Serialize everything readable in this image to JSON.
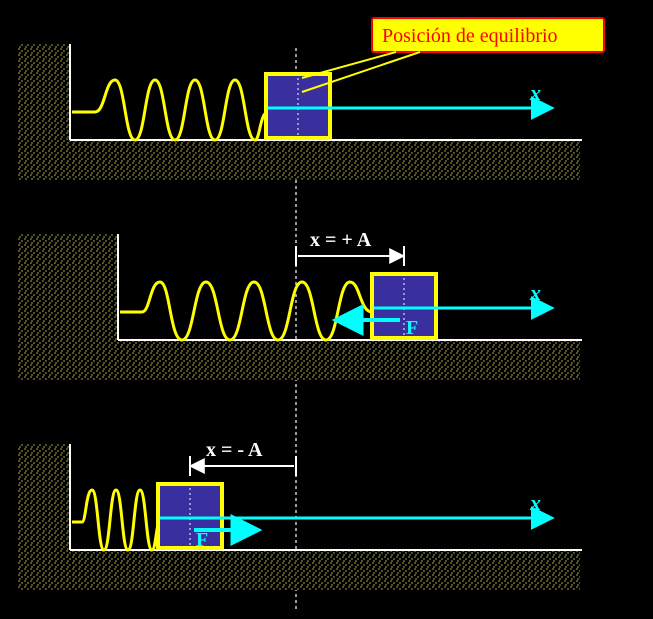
{
  "callout": {
    "label": "Posición de equilibrio"
  },
  "axes": {
    "x1": "x",
    "x2": "x",
    "x3": "x"
  },
  "displacement": {
    "positive": "x = + A",
    "negative": "x = - A"
  },
  "forces": {
    "f2": "F",
    "f3": "F"
  },
  "colors": {
    "spring": "#ffff00",
    "block_fill": "#3a2f9e",
    "block_stroke": "#ffff00",
    "axis": "#00ffff",
    "wall_stipple": "#8a8a3a",
    "floor": "#ffffff",
    "callout_fill": "#ffff00",
    "callout_stroke": "#ff0000"
  }
}
